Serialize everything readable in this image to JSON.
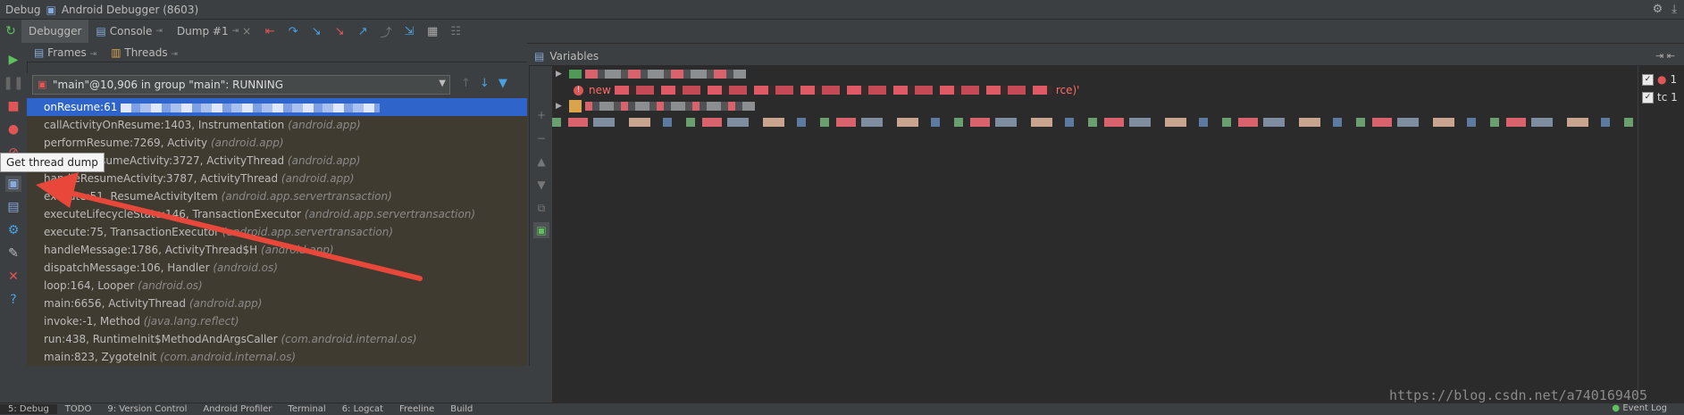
{
  "window": {
    "tool_name": "Debug",
    "title": "Android Debugger (8603)"
  },
  "tabs": [
    {
      "label": "Debugger",
      "active": true
    },
    {
      "label": "Console"
    },
    {
      "label": "Dump #1"
    }
  ],
  "frames_panel": {
    "frames_label": "Frames",
    "threads_label": "Threads"
  },
  "thread_selector": {
    "value": "\"main\"@10,906 in group \"main\": RUNNING"
  },
  "frames": [
    {
      "method": "onResume:61",
      "pkg": ""
    },
    {
      "method": "callActivityOnResume:1403, Instrumentation",
      "pkg": "(android.app)"
    },
    {
      "method": "performResume:7269, Activity",
      "pkg": "(android.app)"
    },
    {
      "method": "performResumeActivity:3727, ActivityThread",
      "pkg": "(android.app)"
    },
    {
      "method": "handleResumeActivity:3787, ActivityThread",
      "pkg": "(android.app)"
    },
    {
      "method": "execute:51, ResumeActivityItem",
      "pkg": "(android.app.servertransaction)"
    },
    {
      "method": "executeLifecycleState:146, TransactionExecutor",
      "pkg": "(android.app.servertransaction)"
    },
    {
      "method": "execute:75, TransactionExecutor",
      "pkg": "(android.app.servertransaction)"
    },
    {
      "method": "handleMessage:1786, ActivityThread$H",
      "pkg": "(android.app)"
    },
    {
      "method": "dispatchMessage:106, Handler",
      "pkg": "(android.os)"
    },
    {
      "method": "loop:164, Looper",
      "pkg": "(android.os)"
    },
    {
      "method": "main:6656, ActivityThread",
      "pkg": "(android.app)"
    },
    {
      "method": "invoke:-1, Method",
      "pkg": "(java.lang.reflect)"
    },
    {
      "method": "run:438, RuntimeInit$MethodAndArgsCaller",
      "pkg": "(com.android.internal.os)"
    },
    {
      "method": "main:823, ZygoteInit",
      "pkg": "(com.android.internal.os)"
    }
  ],
  "tooltip": {
    "text": "Get thread dump"
  },
  "variables_panel": {
    "label": "Variables"
  },
  "variables": [
    {
      "prefix": "",
      "suffix": ""
    },
    {
      "prefix": "new",
      "suffix": "rce)'"
    },
    {
      "prefix": "",
      "suffix": ""
    }
  ],
  "watches": [
    {
      "label": "1"
    },
    {
      "label": "tc 1"
    }
  ],
  "status_bar": {
    "items": [
      {
        "label": "5: Debug",
        "active": true
      },
      {
        "label": "TODO"
      },
      {
        "label": "9: Version Control"
      },
      {
        "label": "Android Profiler"
      },
      {
        "label": "Terminal"
      },
      {
        "label": "6: Logcat"
      },
      {
        "label": "Freeline"
      },
      {
        "label": "Build"
      }
    ],
    "event_log": "Event Log"
  },
  "watermark": "https://blog.csdn.net/a740169405",
  "colors": {
    "selection": "#2f65ca",
    "frames_bg": "#3f3b30",
    "error": "#ff6b68",
    "arrow": "#e8473a"
  }
}
